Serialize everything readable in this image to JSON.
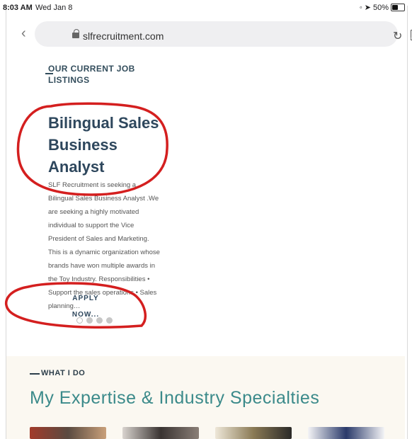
{
  "status_bar": {
    "time": "8:03 AM",
    "date": "Wed Jan 8",
    "battery": "50%",
    "battery_level": 0.5
  },
  "browser": {
    "back_icon": "chevron-left-icon",
    "url": "slfrecruitment.com",
    "reload_icon": "reload-icon",
    "bookmark_icon": "bookmark-icon"
  },
  "listings": {
    "section_label": "OUR CURRENT JOB LISTINGS",
    "job_title": "Bilingual Sales Business Analyst",
    "job_description": "SLF Recruitment is seeking a Bilingual Sales Business Analyst .We are seeking a highly motivated individual to support the Vice President of Sales and Marketing. This is a dynamic organization whose brands have won multiple awards in the Toy Industry. Responsibilities • Support the sales operations • Sales planning…",
    "apply_label": "APPLY NOW...",
    "carousel": {
      "count": 4,
      "active": 0
    }
  },
  "expertise": {
    "section_label": "WHAT I DO",
    "title": "My Expertise & Industry Specialties"
  },
  "colors": {
    "heading": "#2e475d",
    "accent_teal": "#3b8a8a",
    "annotation_red": "#d41f1f",
    "section_bg": "#fbf8f1"
  }
}
